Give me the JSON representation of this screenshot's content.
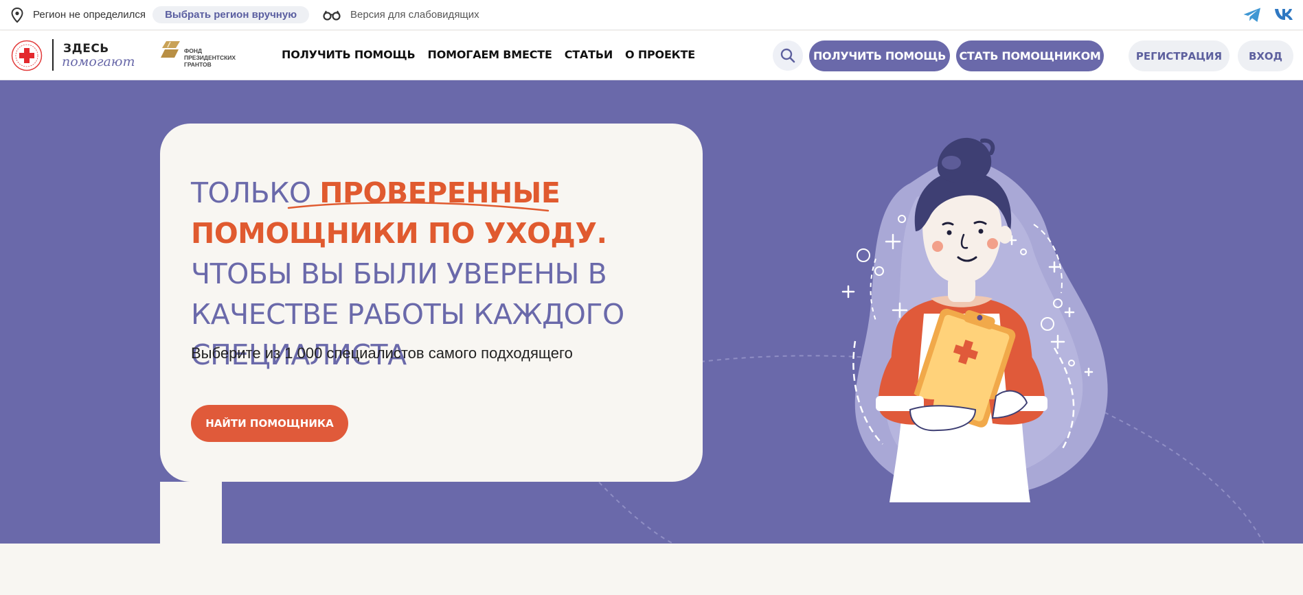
{
  "topbar": {
    "region_status": "Регион не определился",
    "region_button": "Выбрать регион вручную",
    "vision_version": "Версия для слабовидящих",
    "icons": [
      "location-pin-icon",
      "glasses-icon",
      "telegram-icon",
      "vk-icon"
    ]
  },
  "logo": {
    "brand_line1": "ЗДЕСЬ",
    "brand_line2": "помогают",
    "fund_text": "ФОНД ПРЕЗИДЕНТСКИХ ГРАНТОВ"
  },
  "nav": {
    "items": [
      {
        "label": "ПОЛУЧИТЬ ПОМОЩЬ"
      },
      {
        "label": "ПОМОГАЕМ ВМЕСТЕ"
      },
      {
        "label": "СТАТЬИ"
      },
      {
        "label": "О ПРОЕКТЕ"
      }
    ],
    "get_help_button": "ПОЛУЧИТЬ ПОМОЩЬ",
    "become_helper_button": "СТАТЬ ПОМОЩНИКОМ",
    "register_button": "РЕГИСТРАЦИЯ",
    "login_button": "ВХОД"
  },
  "hero": {
    "headline_prefix": "ТОЛЬКО ",
    "headline_highlight": "ПРОВЕРЕННЫЕ ПОМОЩНИКИ ПО УХОДУ.",
    "headline_suffix": " ЧТОБЫ ВЫ БЫЛИ УВЕРЕНЫ В КАЧЕСТВЕ РАБОТЫ КАЖДОГО СПЕЦИАЛИСТА",
    "subtitle": "Выберите из 1 000 специалистов самого подходящего",
    "cta_button": "НАЙТИ ПОМОЩНИКА"
  },
  "colors": {
    "brand_purple": "#6a69aa",
    "accent_orange": "#e05a2f",
    "cream": "#f8f6f2"
  }
}
